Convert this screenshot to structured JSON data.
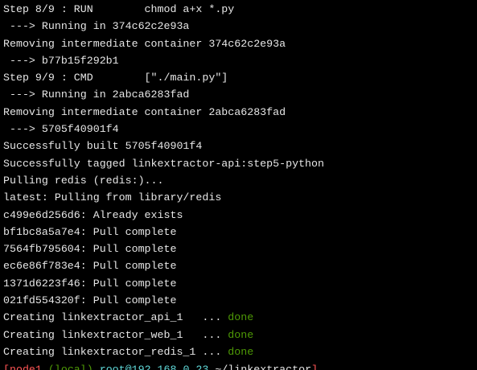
{
  "terminal": {
    "lines": [
      "Step 8/9 : RUN        chmod a+x *.py",
      " ---> Running in 374c62c2e93a",
      "Removing intermediate container 374c62c2e93a",
      " ---> b77b15f292b1",
      "Step 9/9 : CMD        [\"./main.py\"]",
      " ---> Running in 2abca6283fad",
      "Removing intermediate container 2abca6283fad",
      " ---> 5705f40901f4",
      "Successfully built 5705f40901f4",
      "Successfully tagged linkextractor-api:step5-python",
      "Pulling redis (redis:)...",
      "latest: Pulling from library/redis",
      "c499e6d256d6: Already exists",
      "bf1bc8a5a7e4: Pull complete",
      "7564fb795604: Pull complete",
      "ec6e86f783e4: Pull complete",
      "1371d6223f46: Pull complete",
      "021fd554320f: Pull complete"
    ],
    "creating_lines": [
      {
        "prefix": "Creating linkextractor_api_1   ... ",
        "status": "done"
      },
      {
        "prefix": "Creating linkextractor_web_1   ... ",
        "status": "done"
      },
      {
        "prefix": "Creating linkextractor_redis_1 ... ",
        "status": "done"
      }
    ],
    "prompt": {
      "open": "[",
      "user": "node1",
      "env": "(local)",
      "host": "root@192.168.0.23",
      "path": "~/linkextractor",
      "close": "]"
    },
    "colors": {
      "background": "#000000",
      "text": "#e6e6e6",
      "done": "#4e9a06",
      "prompt_red": "#ff5555",
      "prompt_cyan": "#5fd7d7"
    }
  }
}
